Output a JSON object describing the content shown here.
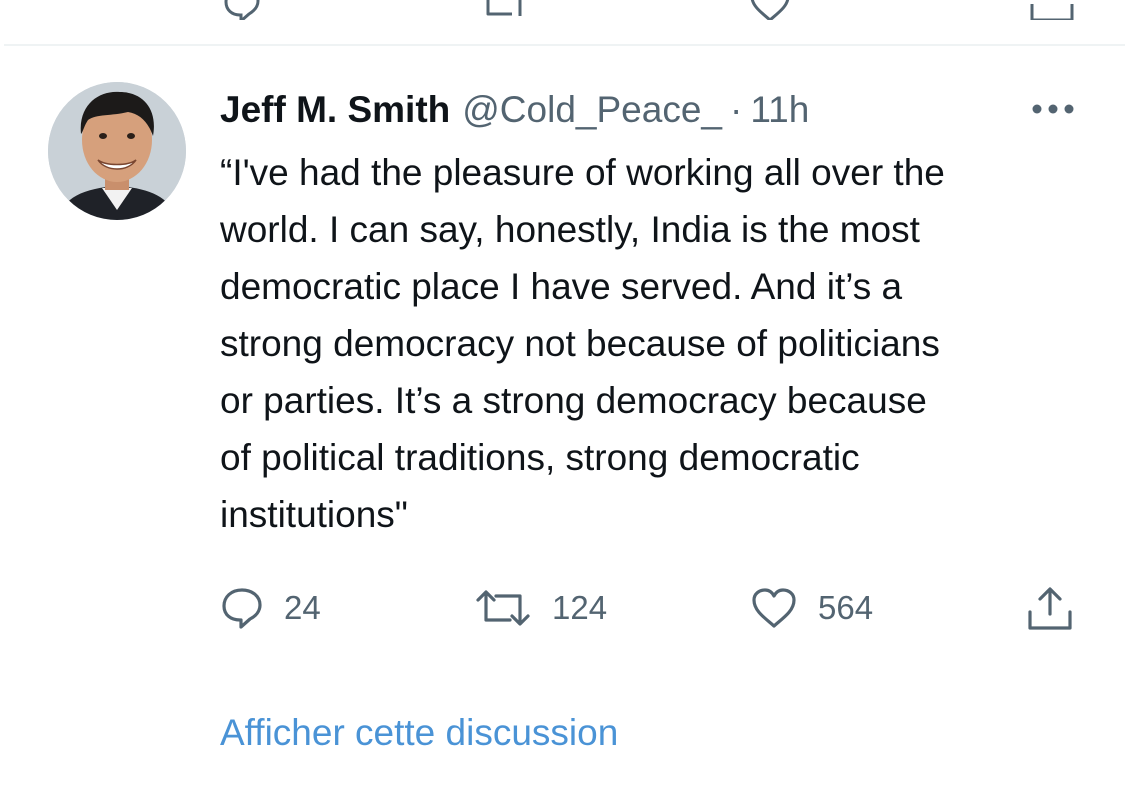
{
  "tweet": {
    "author_name": "Jeff M. Smith",
    "handle": "@Cold_Peace_",
    "separator": "·",
    "time": "11h",
    "text_lines": [
      "“I've had the pleasure of working all over the",
      "world. I can say, honestly, India is the most",
      "democratic place I have served. And it’s a",
      "strong democracy not because of politicians",
      "or parties. It’s a strong democracy because",
      "of political traditions, strong democratic",
      "institutions\""
    ],
    "replies": "24",
    "retweets": "124",
    "likes": "564",
    "show_thread": "Afficher cette discussion"
  },
  "icons": {
    "reply": "reply-icon",
    "retweet": "retweet-icon",
    "like": "heart-icon",
    "share": "share-icon",
    "more": "more-icon"
  },
  "colors": {
    "text": "#0f1419",
    "secondary": "#536471",
    "link": "#4a93d6",
    "divider": "#eff3f4"
  }
}
